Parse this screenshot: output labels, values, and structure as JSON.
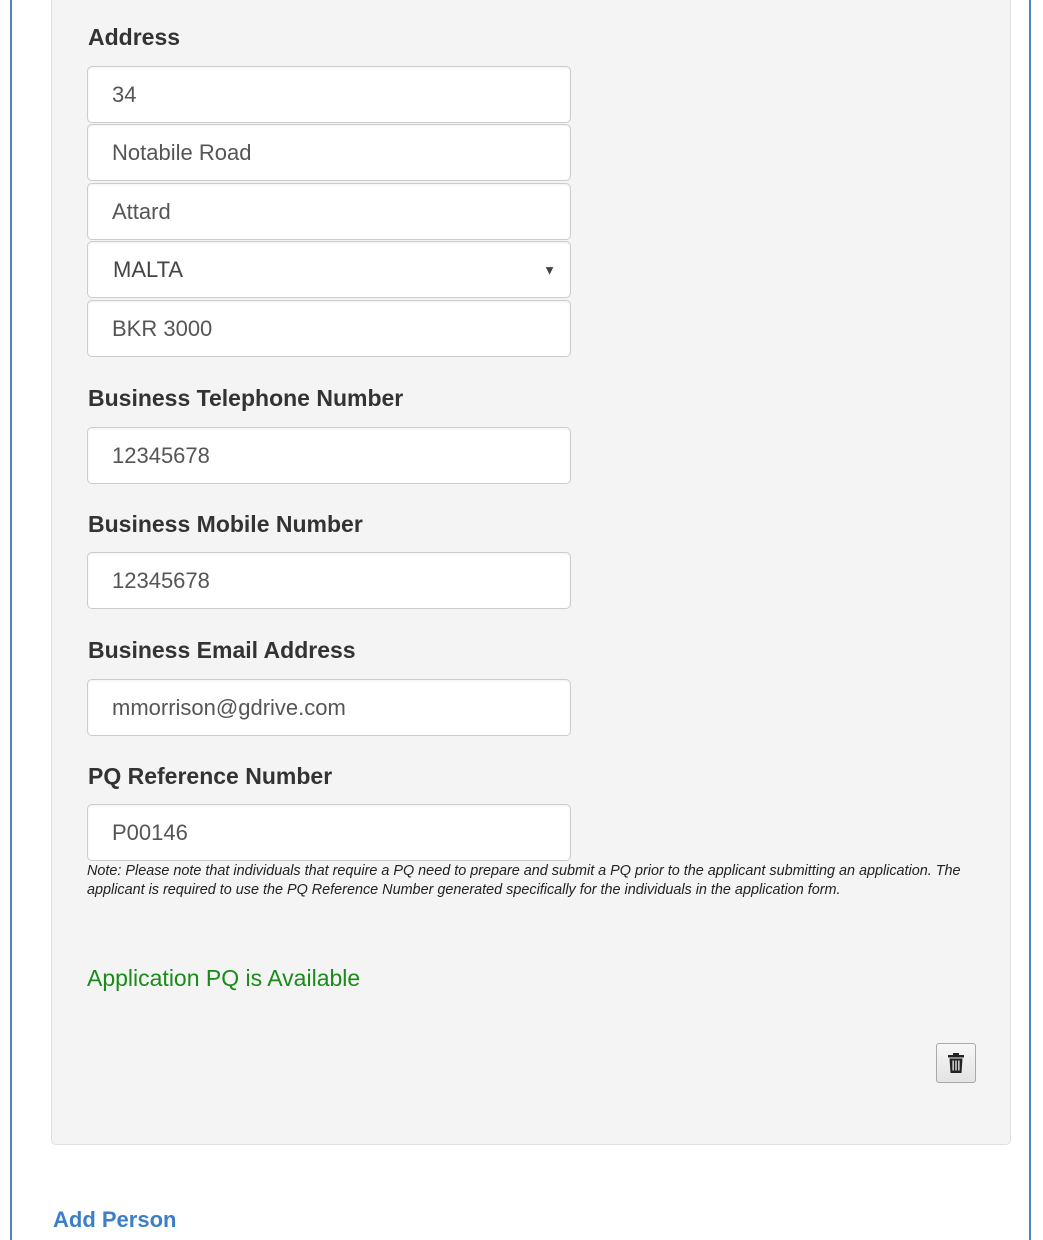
{
  "form": {
    "address_label": "Address",
    "address_lines": [
      "34",
      "Notabile Road",
      "Attard"
    ],
    "country_value": "MALTA",
    "postcode": "BKR 3000",
    "telephone_label": "Business Telephone Number",
    "telephone_value": "12345678",
    "mobile_label": "Business Mobile Number",
    "mobile_value": "12345678",
    "email_label": "Business Email Address",
    "email_value": "mmorrison@gdrive.com",
    "pq_label": "PQ Reference Number",
    "pq_value": "P00146",
    "note": "Note: Please note that individuals that require a PQ need to prepare and submit a PQ prior to the applicant submitting an application. The applicant is required to use the PQ Reference Number generated specifically for the individuals in the application form.",
    "pq_status": "Application PQ is Available",
    "pq_status_color": "#1a8a1a"
  },
  "actions": {
    "delete_icon": "trash-icon",
    "add_person_label": "Add Person",
    "link_color": "#3d7fc4"
  }
}
